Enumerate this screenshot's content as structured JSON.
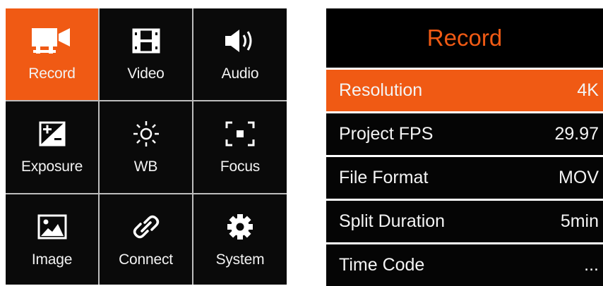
{
  "menu": {
    "tiles": [
      {
        "label": "Record",
        "icon": "video-camera-icon",
        "active": true
      },
      {
        "label": "Video",
        "icon": "film-strip-icon"
      },
      {
        "label": "Audio",
        "icon": "speaker-icon"
      },
      {
        "label": "Exposure",
        "icon": "exposure-compensation-icon"
      },
      {
        "label": "WB",
        "icon": "sun-icon"
      },
      {
        "label": "Focus",
        "icon": "focus-frame-icon"
      },
      {
        "label": "Image",
        "icon": "picture-icon"
      },
      {
        "label": "Connect",
        "icon": "link-icon"
      },
      {
        "label": "System",
        "icon": "gear-icon"
      }
    ]
  },
  "panel": {
    "title": "Record",
    "rows": [
      {
        "label": "Resolution",
        "value": "4K",
        "active": true
      },
      {
        "label": "Project FPS",
        "value": "29.97"
      },
      {
        "label": "File Format",
        "value": "MOV"
      },
      {
        "label": "Split Duration",
        "value": "5min"
      },
      {
        "label": "Time Code",
        "value": "..."
      }
    ]
  },
  "colors": {
    "accent": "#f05a14",
    "tile_bg": "#0a0a0a",
    "divider": "#bdbdbd"
  }
}
